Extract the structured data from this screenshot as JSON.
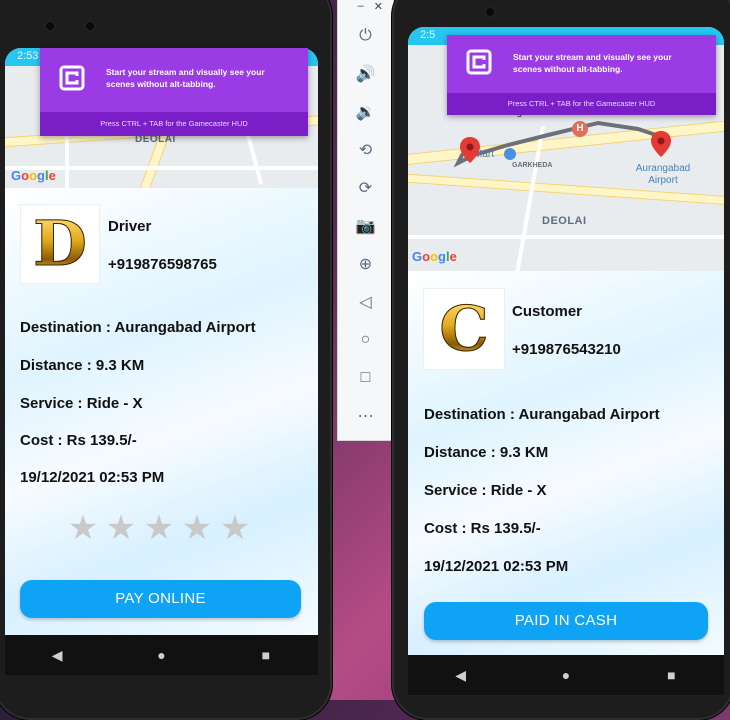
{
  "status_bar": {
    "left_time": "2:53",
    "right_time": "2:5"
  },
  "gamecaster": {
    "message": "Start your stream and visually see your scenes without alt-tabbing.",
    "hint": "Press CTRL + TAB for the Gamecaster HUD"
  },
  "map_left": {
    "area_label": "DEOLAI",
    "google": "Google"
  },
  "map_right": {
    "area_label": "DEOLAI",
    "city_label": "Aurangabad",
    "store_label": "D Mart",
    "locality_label": "GARKHEDA",
    "airport_label": "Aurangabad Airport",
    "google": "Google"
  },
  "left_card": {
    "avatar_letter": "D",
    "role": "Driver",
    "phone": "+919876598765",
    "destination": "Destination : Aurangabad Airport",
    "distance": "Distance : 9.3 KM",
    "service": "Service : Ride - X",
    "cost": "Cost : Rs 139.5/-",
    "datetime": "19/12/2021 02:53 PM",
    "rating_value": 0,
    "rating_max": 5,
    "button_label": "PAY ONLINE"
  },
  "right_card": {
    "avatar_letter": "C",
    "role": "Customer",
    "phone": "+919876543210",
    "destination": "Destination : Aurangabad Airport",
    "distance": "Distance : 9.3 KM",
    "service": "Service : Ride - X",
    "cost": "Cost : Rs 139.5/-",
    "datetime": "19/12/2021 02:53 PM",
    "button_label": "PAID IN CASH"
  },
  "toolbar": {
    "items": [
      "power-icon",
      "volume-up-icon",
      "volume-down-icon",
      "rotate-left-icon",
      "rotate-right-icon",
      "camera-icon",
      "zoom-icon",
      "back-icon",
      "home-icon",
      "overview-icon",
      "more-icon"
    ]
  },
  "colors": {
    "accent_blue": "#0fa3f5",
    "status_bar": "#26c6f0",
    "overlay_purple": "#8e30dd"
  }
}
